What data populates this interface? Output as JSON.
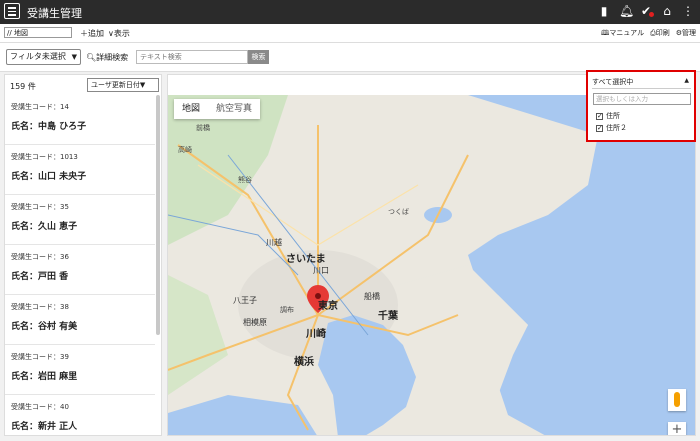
{
  "app": {
    "title": "受講生管理"
  },
  "topbar": {
    "icons": [
      "bookmark-icon",
      "bell-icon",
      "check-icon",
      "home-icon",
      "more-icon"
    ]
  },
  "toolbar": {
    "view_select": "// 地図",
    "add_label": "＋追加",
    "show_label": "∨表示",
    "manual_label": "マニュアル",
    "print_label": "印刷",
    "admin_label": "管理"
  },
  "filter": {
    "select_value": "フィルタ未選択",
    "detail_search": "詳細検索",
    "search_placeholder": "テキスト検索",
    "search_button": "検索"
  },
  "list": {
    "count": "159 件",
    "sort_value": "ユーザ更新日付▼",
    "items": [
      {
        "code": "受講生コード：14",
        "name": "氏名：中島 ひろ子"
      },
      {
        "code": "受講生コード：1013",
        "name": "氏名：山口 未央子"
      },
      {
        "code": "受講生コード：35",
        "name": "氏名：久山 恵子"
      },
      {
        "code": "受講生コード：36",
        "name": "氏名：戸田 香"
      },
      {
        "code": "受講生コード：38",
        "name": "氏名：谷村 有美"
      },
      {
        "code": "受講生コード：39",
        "name": "氏名：岩田 麻里"
      },
      {
        "code": "受講生コード：40",
        "name": "氏名：新井 正人"
      }
    ]
  },
  "map": {
    "type_map": "地図",
    "type_satellite": "航空写真",
    "labels": {
      "saitama": "さいたま",
      "tokyo": "東京",
      "chiba": "千葉",
      "kawasaki": "川崎",
      "yokohama": "横浜",
      "kawagoe": "川越",
      "kawaguchi": "川口",
      "funabashi": "船橋",
      "hachioji": "八王子",
      "sagamihara": "相模原",
      "takasaki": "高崎",
      "maebashi": "前橋",
      "kumagaya": "熊谷",
      "tsukuba": "つくば",
      "chofu": "調布"
    }
  },
  "location_filter": {
    "header": "すべて選択中",
    "search_placeholder": "選択もしくは入力",
    "options": [
      {
        "label": "住所",
        "checked": true
      },
      {
        "label": "住所２",
        "checked": true
      }
    ]
  },
  "colors": {
    "topbar": "#2b2b2b",
    "highlight": "#e00000",
    "water": "#a8c8f0",
    "marker": "#e53935"
  }
}
